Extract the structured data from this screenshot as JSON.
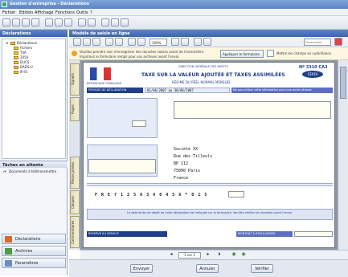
{
  "window": {
    "title": "Gestion d'entreprise - Déclarations"
  },
  "menu": [
    "Fichier",
    "Edition",
    "Affichage",
    "Fonctions",
    "Outils",
    "?"
  ],
  "left_pane": {
    "header": "Déclarations",
    "tree_root": "Déclarations",
    "tree_items": [
      "Fichiers",
      "TVA",
      "2050",
      "DUCS",
      "DADS-U",
      "IR-IS"
    ],
    "tasks_header": "Tâches en attente",
    "task_item": "Documents à télétransmettre",
    "nav_buttons": [
      "Déclarations",
      "Archives",
      "Paramètres"
    ]
  },
  "main": {
    "header": "Modèle de saisie en ligne",
    "zoom": "100%",
    "search_placeholder": "Rechercher",
    "msg_line1": "Veuillez prendre soin d'enregistrer des données saisies avant de transmettre.",
    "msg_line2": "Imprimez le formulaire rempli pour vos archives avant l'envoi.",
    "msg_btn1": "Appliquer le formulaire",
    "msg_btn2": "Mettre les champs en surbrillance",
    "side_tabs": [
      "Signets",
      "Pages",
      "Pièces jointes",
      "Calques",
      "Commentaires"
    ],
    "nav": {
      "page": "1 sur 1"
    }
  },
  "form": {
    "republic": "RÉPUBLIQUE FRANÇAISE",
    "direction": "DIRECTION GÉNÉRALE DES IMPÔTS",
    "title": "TAXE SUR LA VALEUR AJOUTÉE ET TAXES ASSIMILÉES",
    "subtitle": "RÉGIME DU RÉEL NORMAL   MENSUEL",
    "form_no": "Nº 3310 CA3",
    "cerfa": "CERFA",
    "period_label": "PÉRIODE DE DÉCLARATION",
    "period_value": "01/06/2007 au 30/06/2007",
    "info_banner": "Ne pas utiliser cette déclaration pour une autre période",
    "addr_lines": [
      "Société XX",
      "Rue des Tilleuls",
      "BP 112",
      "75000 Paris",
      "France"
    ],
    "code_line": "F R E 7 1 2 5 6 3 4 0 4 5 6 * 0 1 5",
    "notice": "La date limite de dépôt de votre déclaration est indiquée sur le formulaire. Veuillez vérifier les données avant l'envoi.",
    "bottom_left": "RÉSERVÉ AU SERVICE",
    "bottom_right": "MONTANT À REGULARISER"
  },
  "buttons": {
    "b1": "Envoyer",
    "b2": "Annuler",
    "b3": "Vérifier"
  },
  "colors": {
    "accent": "#3b64a8",
    "form_blue": "#1e3f8a",
    "banner": "#5b6fc1"
  }
}
